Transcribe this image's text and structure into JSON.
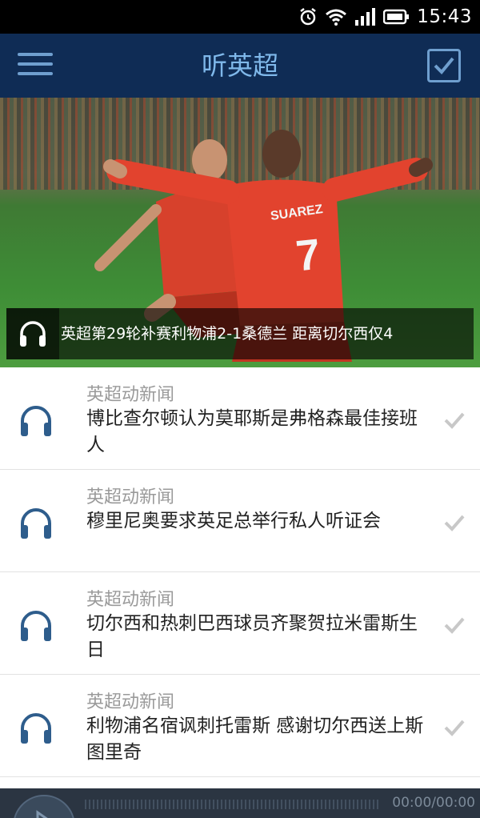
{
  "status_bar": {
    "time": "15:43",
    "icons": [
      "alarm-icon",
      "wifi-icon",
      "signal-icon",
      "battery-icon"
    ]
  },
  "app_bar": {
    "title": "听英超",
    "menu_icon": "hamburger-menu-icon",
    "action_icon": "checkbox-icon"
  },
  "hero": {
    "caption": "英超第29轮补赛利物浦2-1桑德兰 距离切尔西仅4",
    "icon": "headphones-icon",
    "jersey_text": "SUAREZ",
    "jersey_number": "7"
  },
  "news": [
    {
      "category": "英超动新闻",
      "title": "博比查尔顿认为莫耶斯是弗格森最佳接班人"
    },
    {
      "category": "英超动新闻",
      "title": "穆里尼奥要求英足总举行私人听证会"
    },
    {
      "category": "英超动新闻",
      "title": "切尔西和热刺巴西球员齐聚贺拉米雷斯生日"
    },
    {
      "category": "英超动新闻",
      "title": "利物浦名宿讽刺托雷斯 感谢切尔西送上斯图里奇"
    }
  ],
  "player": {
    "time": "00:00/00:00"
  },
  "colors": {
    "header_bg": "#0f2c55",
    "header_title": "#7fb8ea",
    "icon_blue": "#2e5d8c",
    "category_gray": "#9a9a9a"
  }
}
